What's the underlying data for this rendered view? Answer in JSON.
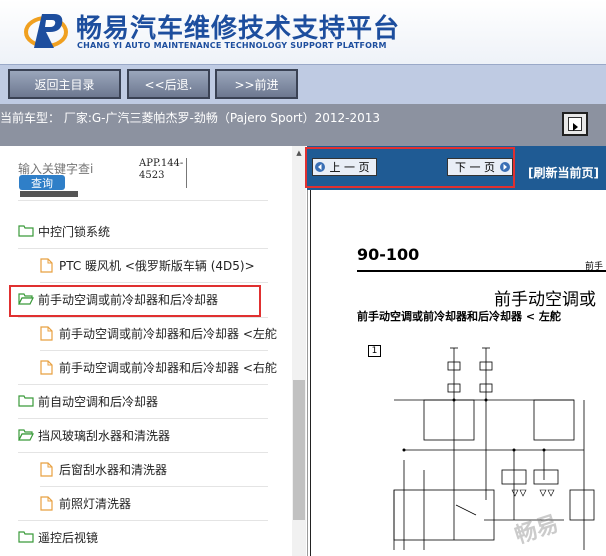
{
  "header": {
    "title": "畅易汽车维修技术支持平台",
    "subtitle": "CHANG YI AUTO MAINTENANCE TECHNOLOGY SUPPORT PLATFORM",
    "brand_color": "#1d4e9e"
  },
  "nav": {
    "home": "返回主目录",
    "back": "<<后退.",
    "forward": ">>前进"
  },
  "info": {
    "current_model": "当前车型：  厂家:G-广汽三菱帕杰罗-劲畅（Pajero Sport）2012-2013"
  },
  "search": {
    "placeholder": "输入关键字查i",
    "button": "查询",
    "code": "APP.144-",
    "code2": "4523"
  },
  "tree": {
    "items": [
      {
        "label": "中控门锁系统",
        "type": "folder"
      },
      {
        "label": "PTC 暖风机 <俄罗斯版车辆 (4D5)>",
        "type": "doc"
      },
      {
        "label": "前手动空调或前冷却器和后冷却器",
        "type": "folder"
      },
      {
        "label": "前手动空调或前冷却器和后冷却器 <左舵",
        "type": "doc"
      },
      {
        "label": "前手动空调或前冷却器和后冷却器 <右舵",
        "type": "doc"
      },
      {
        "label": "前自动空调和后冷却器",
        "type": "folder"
      },
      {
        "label": "挡风玻璃刮水器和清洗器",
        "type": "folder"
      },
      {
        "label": "后窗刮水器和清洗器",
        "type": "doc"
      },
      {
        "label": "前照灯清洗器",
        "type": "doc"
      },
      {
        "label": "遥控后视镜",
        "type": "folder"
      }
    ]
  },
  "viewer": {
    "prev": "上 一 页",
    "next": "下 一 页",
    "refresh": "[刷新当前页]",
    "bar_color": "#1f5b94"
  },
  "page": {
    "number": "90-100",
    "tag": "前手",
    "title": "前手动空调或",
    "subtitle": "前手动空调或前冷却器和后冷却器 < 左舵",
    "box": "1"
  },
  "watermark": "畅易"
}
